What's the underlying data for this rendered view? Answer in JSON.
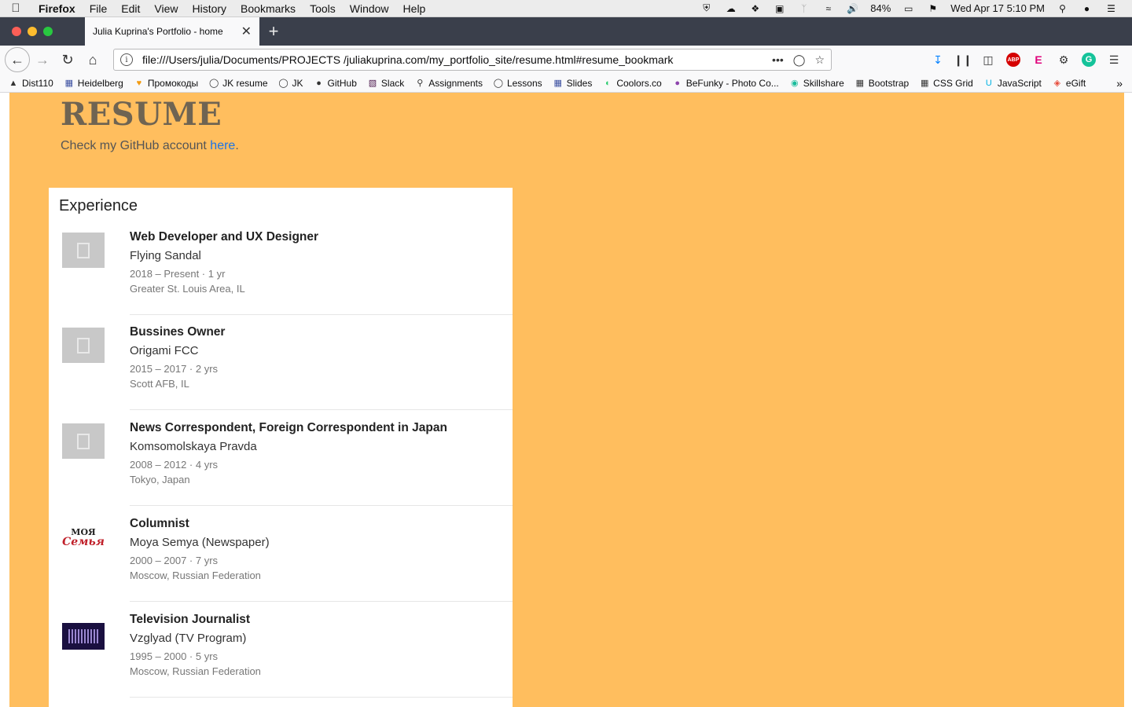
{
  "menubar": {
    "app": "Firefox",
    "items": [
      "File",
      "Edit",
      "View",
      "History",
      "Bookmarks",
      "Tools",
      "Window",
      "Help"
    ],
    "battery": "84%",
    "datetime": "Wed Apr 17  5:10 PM"
  },
  "tab": {
    "title": "Julia Kuprina's Portfolio - home"
  },
  "navbar": {
    "url": "file:///Users/julia/Documents/PROJECTS /juliakuprina.com/my_portfolio_site/resume.html#resume_bookmark"
  },
  "bookmarks": [
    {
      "label": "Dist110",
      "icon": "landscape-icon"
    },
    {
      "label": "Heidelberg",
      "icon": "calendar-icon"
    },
    {
      "label": "Промокоды",
      "icon": "heart-icon"
    },
    {
      "label": "JK resume",
      "icon": "globe-icon"
    },
    {
      "label": "JK",
      "icon": "globe-icon"
    },
    {
      "label": "GitHub",
      "icon": "github-icon"
    },
    {
      "label": "Slack",
      "icon": "slack-icon"
    },
    {
      "label": "Assignments",
      "icon": "pin-icon"
    },
    {
      "label": "Lessons",
      "icon": "globe-icon"
    },
    {
      "label": "Slides",
      "icon": "calendar-icon"
    },
    {
      "label": "Coolors.co",
      "icon": "palette-icon"
    },
    {
      "label": "BeFunky - Photo Co...",
      "icon": "befunky-icon"
    },
    {
      "label": "Skillshare",
      "icon": "skillshare-icon"
    },
    {
      "label": "Bootstrap",
      "icon": "grid-icon"
    },
    {
      "label": "CSS Grid",
      "icon": "grid-icon"
    },
    {
      "label": "JavaScript",
      "icon": "udacity-icon"
    },
    {
      "label": "eGift",
      "icon": "gift-icon"
    }
  ],
  "page": {
    "title": "RESUME",
    "github_text": "Check my GitHub account ",
    "github_link": "here",
    "github_period": "."
  },
  "experience": {
    "heading": "Experience",
    "jobs": [
      {
        "title": "Web Developer and UX Designer",
        "company": "Flying Sandal",
        "dates": "2018 – Present · 1 yr",
        "location": "Greater St. Louis Area, IL",
        "logo": "placeholder"
      },
      {
        "title": "Bussines Owner",
        "company": "Origami FCC",
        "dates": "2015 – 2017 · 2 yrs",
        "location": "Scott AFB, IL",
        "logo": "placeholder"
      },
      {
        "title": "News Correspondent, Foreign Correspondent in Japan",
        "company": "Komsomolskaya Pravda",
        "dates": "2008 – 2012 · 4 yrs",
        "location": "Tokyo, Japan",
        "logo": "placeholder"
      },
      {
        "title": "Columnist",
        "company": "Moya Semya (Newspaper)",
        "dates": "2000 – 2007 · 7 yrs",
        "location": "Moscow, Russian Federation",
        "logo": "moya"
      },
      {
        "title": "Television Journalist",
        "company": "Vzglyad (TV Program)",
        "dates": "1995 – 2000 · 5 yrs",
        "location": "Moscow, Russian Federation",
        "logo": "vz"
      }
    ]
  },
  "logos": {
    "moya_top": "МОЯ",
    "moya_bottom": "Семья"
  },
  "colors": {
    "page_bg": "#ffbe5e",
    "link": "#1a73e8",
    "title": "#6f6452"
  }
}
